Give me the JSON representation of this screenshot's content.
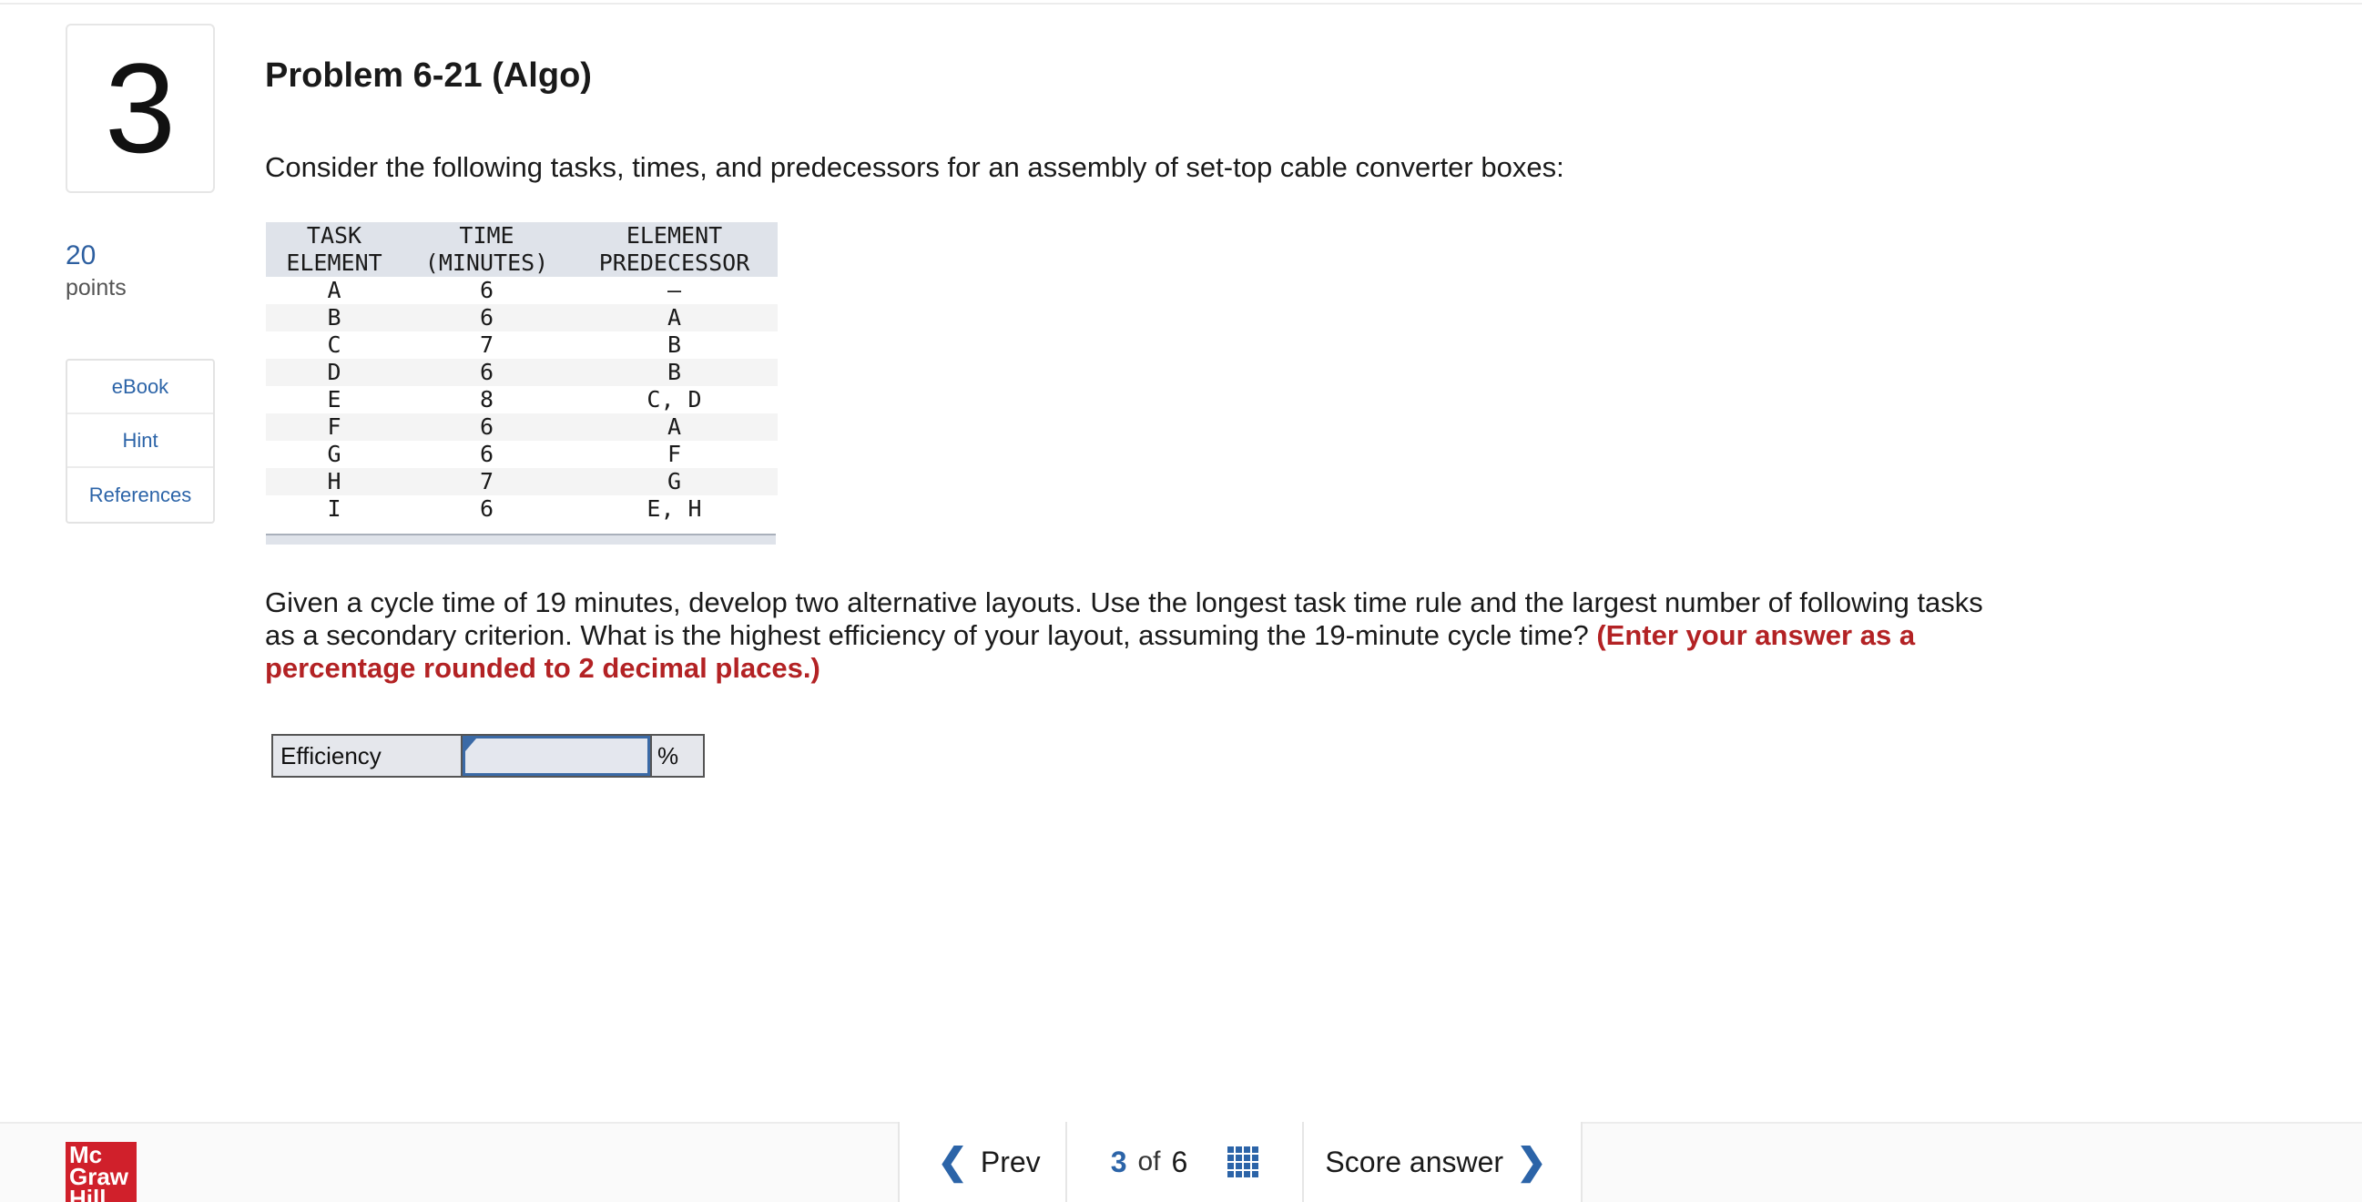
{
  "question": {
    "number": "3",
    "points_value": "20",
    "points_label": "points",
    "title": "Problem 6-21 (Algo)",
    "intro": "Consider the following tasks, times, and predecessors for an assembly of set-top cable converter boxes:"
  },
  "side_nav": {
    "items": [
      {
        "label": "eBook"
      },
      {
        "label": "Hint"
      },
      {
        "label": "References"
      }
    ]
  },
  "task_table": {
    "headers": [
      [
        "TASK",
        "ELEMENT"
      ],
      [
        "TIME",
        "(MINUTES)"
      ],
      [
        "ELEMENT",
        "PREDECESSOR"
      ]
    ],
    "rows": [
      [
        "A",
        "6",
        "—"
      ],
      [
        "B",
        "6",
        "A"
      ],
      [
        "C",
        "7",
        "B"
      ],
      [
        "D",
        "6",
        "B"
      ],
      [
        "E",
        "8",
        "C, D"
      ],
      [
        "F",
        "6",
        "A"
      ],
      [
        "G",
        "6",
        "F"
      ],
      [
        "H",
        "7",
        "G"
      ],
      [
        "I",
        "6",
        "E, H"
      ]
    ]
  },
  "prompt": {
    "text": "Given a cycle time of 19 minutes, develop two alternative layouts. Use the longest task time rule and the largest number of following tasks as a secondary criterion. What is the highest efficiency of your layout, assuming the 19-minute cycle time? ",
    "emphasis": "(Enter your answer as a percentage rounded to 2 decimal places.)"
  },
  "answer": {
    "label": "Efficiency",
    "value": "",
    "unit": "%"
  },
  "footer": {
    "logo_text": [
      "Mc",
      "Graw",
      "Hill"
    ],
    "prev_label": "Prev",
    "current_page": "3",
    "of_label": "of",
    "total_pages": "6",
    "score_label": "Score answer"
  },
  "colors": {
    "accent": "#2c64a8",
    "emphasis": "#b32224",
    "brand": "#d0202b",
    "table_header_bg": "#dfe3ea"
  },
  "icons": [
    "chevron-left-icon",
    "grid-icon",
    "chevron-right-icon"
  ]
}
